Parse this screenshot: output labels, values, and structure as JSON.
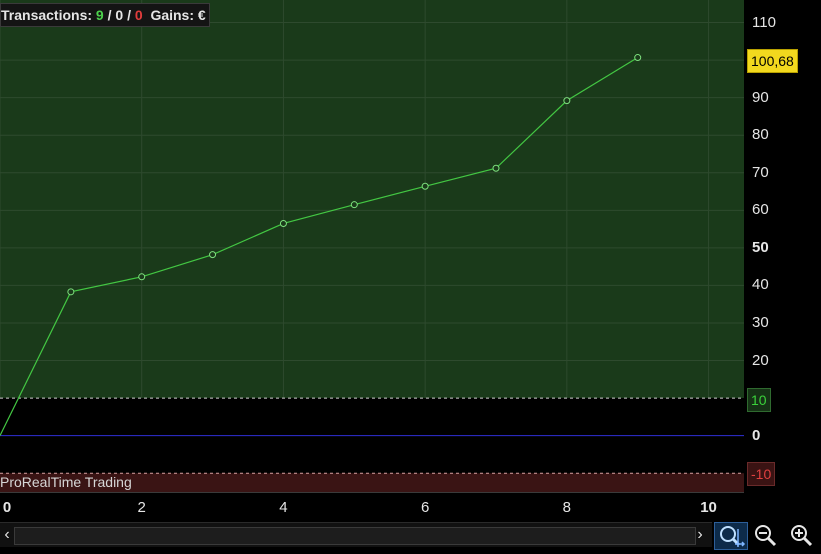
{
  "header": {
    "label": "Transactions:",
    "winners": "9",
    "sep1": "/",
    "neutral": "0",
    "sep2": "/",
    "losers": "0",
    "gains_label": "Gains:",
    "currency": "€"
  },
  "watermark": "ProRealTime Trading",
  "tags": {
    "current": "100,68",
    "upper": "10",
    "lower": "-10"
  },
  "colors": {
    "profit_zone": "#1a3a1a",
    "loss_zone": "#3a1414",
    "line": "#43c743",
    "zero_line": "#2f2fd6",
    "current_tag": "#f2d81e"
  },
  "chart_data": {
    "type": "line",
    "x": [
      0,
      1,
      2,
      3,
      4,
      5,
      6,
      7,
      8,
      9
    ],
    "series": [
      {
        "values": [
          0,
          38.3,
          42.3,
          48.2,
          56.5,
          61.5,
          66.4,
          71.2,
          89.2,
          100.68
        ]
      }
    ],
    "xlim": [
      0,
      10.5
    ],
    "ylim": [
      -15,
      116
    ],
    "x_ticks": [
      "0",
      "2",
      "4",
      "6",
      "8",
      "10"
    ],
    "y_ticks": [
      "110",
      "100",
      "90",
      "80",
      "70",
      "60",
      "50",
      "40",
      "30",
      "20",
      "10",
      "0",
      "-10"
    ],
    "upper_threshold": 10,
    "lower_threshold": -10,
    "grid": true
  },
  "icons": {
    "scroll_left": "chevron-left-icon",
    "scroll_right": "chevron-right-icon",
    "zoom_fit": "zoom-fit-icon",
    "zoom_out": "zoom-out-icon",
    "zoom_in": "zoom-in-icon"
  },
  "scroll_glyphs": {
    "left": "‹",
    "right": "›"
  }
}
